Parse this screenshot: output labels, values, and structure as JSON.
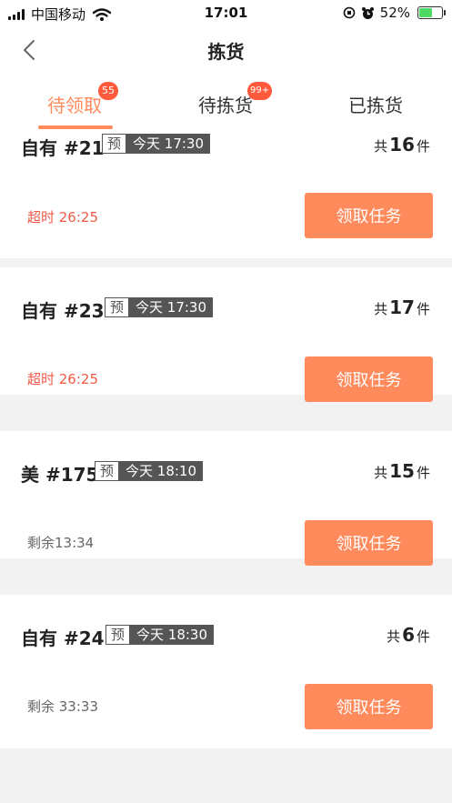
{
  "status_bar": {
    "carrier": "中国移动",
    "time": "17:01",
    "battery": "52%",
    "battery_level": 0.52
  },
  "nav": {
    "title": "拣货"
  },
  "tabs": [
    {
      "label": "待领取",
      "badge": "55"
    },
    {
      "label": "待拣货",
      "badge": "99+"
    },
    {
      "label": "已拣货",
      "badge": ""
    }
  ],
  "orders": [
    {
      "title": "自有 #21",
      "tag_pre": "预",
      "tag_time": "今天 17:30",
      "count_prefix": "共",
      "count": "16",
      "count_unit": "件",
      "timer": "超时 26:25",
      "button": "领取任务"
    },
    {
      "title": "自有 #23",
      "tag_pre": "预",
      "tag_time": "今天 17:30",
      "count_prefix": "共",
      "count": "17",
      "count_unit": "件",
      "timer": "超时 26:25",
      "button": "领取任务"
    },
    {
      "title": "美 #175",
      "tag_pre": "预",
      "tag_time": "今天 18:10",
      "count_prefix": "共",
      "count": "15",
      "count_unit": "件",
      "timer": "剩余13:34",
      "button": "领取任务"
    },
    {
      "title": "自有 #24",
      "tag_pre": "预",
      "tag_time": "今天 18:30",
      "count_prefix": "共",
      "count": "6",
      "count_unit": "件",
      "timer": "剩余 33:33",
      "button": "领取任务"
    }
  ]
}
